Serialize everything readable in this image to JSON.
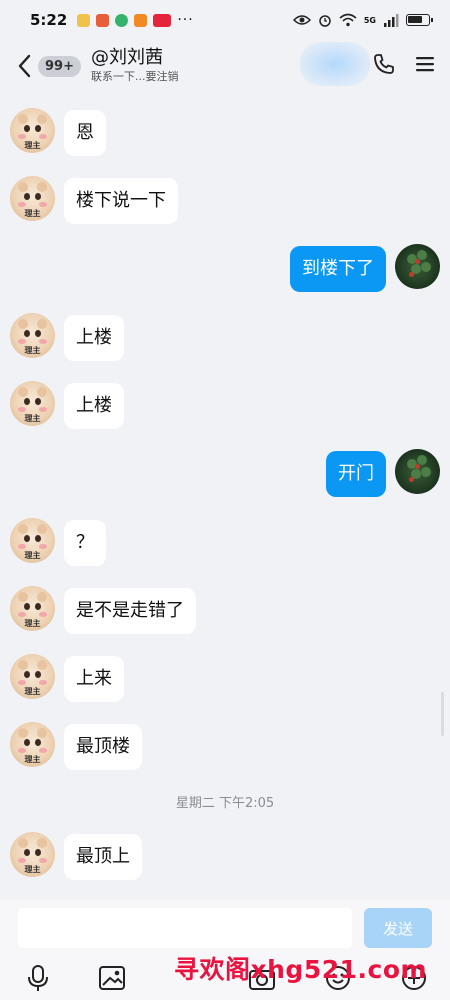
{
  "status_bar": {
    "time": "5:22",
    "network": "5G"
  },
  "header": {
    "unread_count": "99+",
    "title": "@刘刘茜",
    "subtitle": "联系一下...要注销",
    "icons": [
      "back-icon",
      "phone-icon",
      "menu-icon"
    ]
  },
  "avatar_tag": "理主",
  "messages": [
    {
      "side": "in",
      "text": "恩"
    },
    {
      "side": "in",
      "text": "楼下说一下"
    },
    {
      "side": "out",
      "text": "到楼下了"
    },
    {
      "side": "in",
      "text": "上楼"
    },
    {
      "side": "in",
      "text": "上楼"
    },
    {
      "side": "out",
      "text": "开门"
    },
    {
      "side": "in",
      "text": "？"
    },
    {
      "side": "in",
      "text": "是不是走错了"
    },
    {
      "side": "in",
      "text": "上来"
    },
    {
      "side": "in",
      "text": "最顶楼"
    },
    {
      "side": "in",
      "text": "最顶上"
    }
  ],
  "time_divider": "星期二 下午2:05",
  "composer": {
    "input_value": "",
    "send_label": "发送"
  },
  "toolbar_icons": [
    "microphone-icon",
    "image-icon",
    "camera-icon",
    "emoji-icon",
    "plus-icon"
  ],
  "watermark": "寻欢阁xhg521.com",
  "colors": {
    "outgoing_bubble": "#0b97f4",
    "incoming_bubble": "#ffffff",
    "background": "#f1f2f6",
    "send_button": "#a8d4f8",
    "watermark": "#e8133f"
  }
}
